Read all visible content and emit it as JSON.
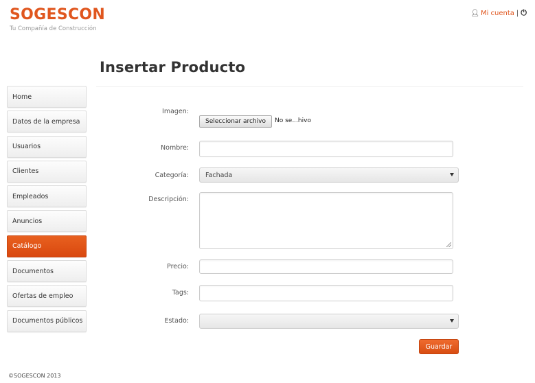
{
  "header": {
    "brand": "SOGESCON",
    "tagline": "Tu Compañía de Construcción",
    "account_link": "Mi cuenta",
    "separator": "|",
    "user_icon": "user-icon",
    "power_icon": "power-icon"
  },
  "page": {
    "title": "Insertar Producto"
  },
  "sidebar": {
    "items": [
      {
        "label": "Home"
      },
      {
        "label": "Datos de la empresa"
      },
      {
        "label": "Usuarios"
      },
      {
        "label": "Clientes"
      },
      {
        "label": "Empleados"
      },
      {
        "label": "Anuncios"
      },
      {
        "label": "Catálogo",
        "active": true
      },
      {
        "label": "Documentos"
      },
      {
        "label": "Ofertas de empleo"
      },
      {
        "label": "Documentos públicos"
      }
    ]
  },
  "form": {
    "image_label": "Imagen:",
    "file_button": "Seleccionar archivo",
    "file_status": "No se...hivo",
    "name_label": "Nombre:",
    "name_value": "",
    "category_label": "Categoría:",
    "category_value": "Fachada",
    "description_label": "Descripción:",
    "description_value": "",
    "price_label": "Precio:",
    "price_value": "",
    "tags_label": "Tags:",
    "tags_value": "",
    "status_label": "Estado:",
    "status_value": "",
    "save_button": "Guardar"
  },
  "footer": {
    "copyright": "©SOGESCON 2013"
  },
  "colors": {
    "accent": "#e0561e",
    "active_nav": "#e05a1a"
  }
}
